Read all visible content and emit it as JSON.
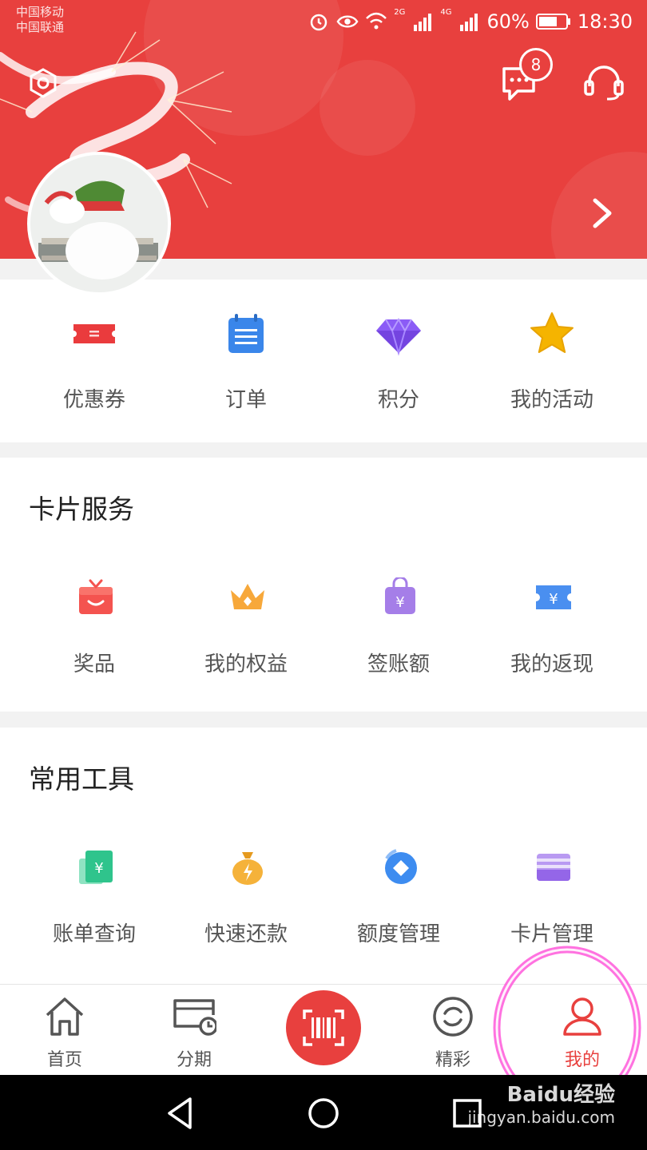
{
  "status_bar": {
    "carrier_1": "中国移动",
    "carrier_2": "中国联通",
    "signal_1_label": "2G",
    "signal_2_label": "4G",
    "battery": "60%",
    "time": "18:30"
  },
  "header": {
    "message_badge": "8",
    "icons": [
      "settings-icon",
      "message-icon",
      "customer-service-icon",
      "chevron-right-icon"
    ]
  },
  "quick_actions": [
    {
      "label": "优惠券",
      "icon": "coupon-icon",
      "color": "#ea3b3d"
    },
    {
      "label": "订单",
      "icon": "order-icon",
      "color": "#3a86ea"
    },
    {
      "label": "积分",
      "icon": "points-diamond-icon",
      "color": "#8b5cf6"
    },
    {
      "label": "我的活动",
      "icon": "activity-star-icon",
      "color": "#f5b400"
    }
  ],
  "card_services": {
    "title": "卡片服务",
    "items": [
      {
        "label": "奖品",
        "icon": "gift-icon"
      },
      {
        "label": "我的权益",
        "icon": "crown-icon"
      },
      {
        "label": "签账额",
        "icon": "spend-bag-icon"
      },
      {
        "label": "我的返现",
        "icon": "cashback-ticket-icon"
      }
    ]
  },
  "common_tools": {
    "title": "常用工具",
    "items": [
      {
        "label": "账单查询",
        "icon": "bill-query-icon"
      },
      {
        "label": "快速还款",
        "icon": "quick-repay-icon"
      },
      {
        "label": "额度管理",
        "icon": "credit-limit-icon"
      },
      {
        "label": "卡片管理",
        "icon": "card-manage-icon"
      }
    ]
  },
  "tab_bar": {
    "tabs": [
      {
        "label": "首页",
        "icon": "home-icon"
      },
      {
        "label": "分期",
        "icon": "installment-icon"
      },
      {
        "label": "",
        "icon": "scan-barcode-icon"
      },
      {
        "label": "精彩",
        "icon": "highlights-icon"
      },
      {
        "label": "我的",
        "icon": "profile-icon"
      }
    ],
    "active_tab": "我的"
  },
  "watermark": {
    "brand": "Baidu经验",
    "url": "jingyan.baidu.com"
  },
  "colors": {
    "brand_red": "#e8403e",
    "text_gray": "#555555",
    "title_dark": "#222222"
  }
}
